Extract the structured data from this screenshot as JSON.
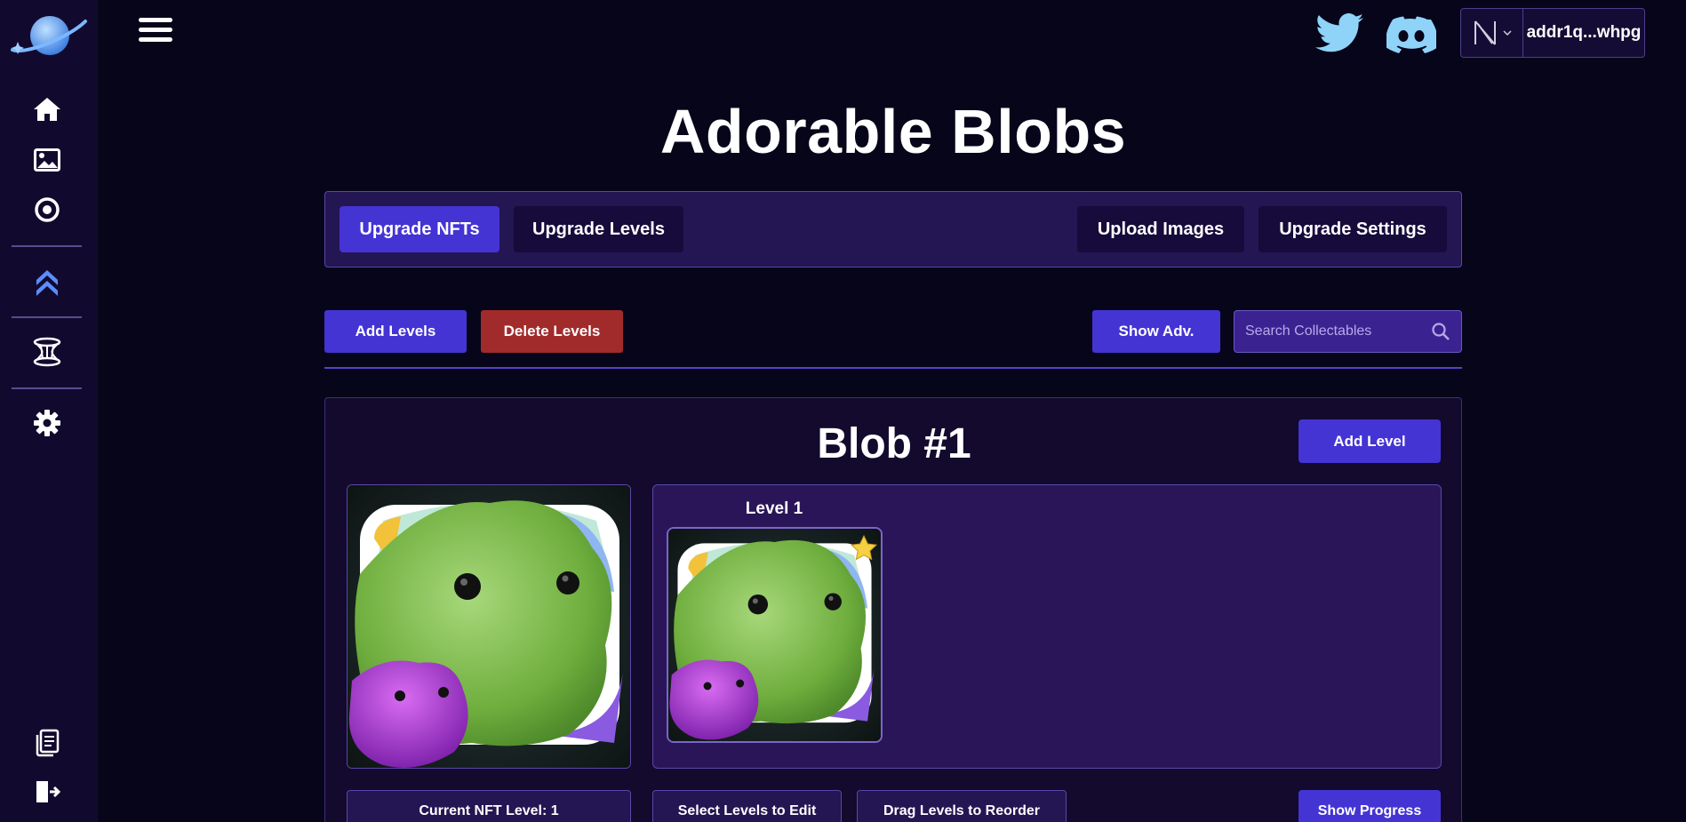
{
  "app": {
    "title": "Adorable Blobs"
  },
  "sidebar": {
    "items": [
      {
        "icon": "home-icon"
      },
      {
        "icon": "image-icon"
      },
      {
        "icon": "circle-dot-icon"
      },
      {
        "icon": "double-chevron-up-icon"
      },
      {
        "icon": "portal-icon"
      },
      {
        "icon": "gear-icon"
      },
      {
        "icon": "document-icon"
      },
      {
        "icon": "logout-icon"
      }
    ]
  },
  "header": {
    "wallet_address": "addr1q...whpg",
    "wallet_icon": "nami-wallet-icon"
  },
  "tabs": {
    "upgrade_nfts": "Upgrade NFTs",
    "upgrade_levels": "Upgrade Levels",
    "upload_images": "Upload Images",
    "upgrade_settings": "Upgrade Settings"
  },
  "toolbar": {
    "add_levels": "Add Levels",
    "delete_levels": "Delete Levels",
    "show_adv": "Show Adv.",
    "search_placeholder": "Search Collectables"
  },
  "card": {
    "title": "Blob #1",
    "add_level": "Add Level",
    "levels": [
      {
        "label": "Level 1"
      }
    ],
    "current_level": "Current NFT Level: 1",
    "select_levels": "Select Levels to Edit",
    "drag_levels": "Drag Levels to Reorder",
    "show_progress": "Show Progress"
  },
  "colors": {
    "background": "#07051a",
    "sidebar": "#120a2e",
    "accent": "#4434d4",
    "danger": "#a12b2b",
    "panel": "#241553",
    "social": "#8fd3f8"
  }
}
